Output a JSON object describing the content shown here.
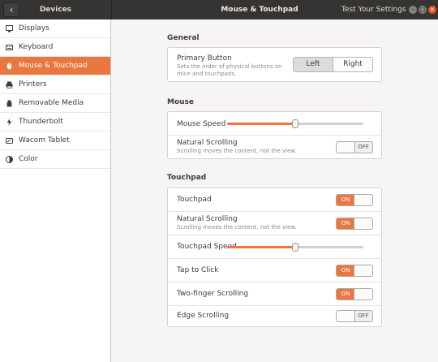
{
  "titlebar": {
    "back_icon": "‹",
    "section": "Devices",
    "title": "Mouse & Touchpad",
    "extra": "Test Your Settings"
  },
  "sidebar": {
    "items": [
      {
        "label": "Displays",
        "icon": "display-icon"
      },
      {
        "label": "Keyboard",
        "icon": "keyboard-icon"
      },
      {
        "label": "Mouse & Touchpad",
        "icon": "mouse-icon",
        "active": true
      },
      {
        "label": "Printers",
        "icon": "printer-icon"
      },
      {
        "label": "Removable Media",
        "icon": "removable-media-icon"
      },
      {
        "label": "Thunderbolt",
        "icon": "thunderbolt-icon"
      },
      {
        "label": "Wacom Tablet",
        "icon": "tablet-icon"
      },
      {
        "label": "Color",
        "icon": "color-icon"
      }
    ]
  },
  "general": {
    "title": "General",
    "primary_button": {
      "label": "Primary Button",
      "description": "Sets the order of physical buttons on mice and touchpads.",
      "left": "Left",
      "right": "Right",
      "selected": "Left"
    }
  },
  "mouse": {
    "title": "Mouse",
    "speed": {
      "label": "Mouse Speed",
      "value": 0.5
    },
    "natural_scrolling": {
      "label": "Natural Scrolling",
      "description": "Scrolling moves the content, not the view.",
      "state": "OFF"
    }
  },
  "touchpad": {
    "title": "Touchpad",
    "touchpad": {
      "label": "Touchpad",
      "state": "ON"
    },
    "natural_scrolling": {
      "label": "Natural Scrolling",
      "description": "Scrolling moves the content, not the view.",
      "state": "ON"
    },
    "speed": {
      "label": "Touchpad Speed",
      "value": 0.5
    },
    "tap_to_click": {
      "label": "Tap to Click",
      "state": "ON"
    },
    "two_finger": {
      "label": "Two-finger Scrolling",
      "state": "ON"
    },
    "edge_scrolling": {
      "label": "Edge Scrolling",
      "state": "OFF"
    }
  },
  "colors": {
    "accent": "#e9773f",
    "titlebar": "#353432",
    "close": "#e95420"
  }
}
